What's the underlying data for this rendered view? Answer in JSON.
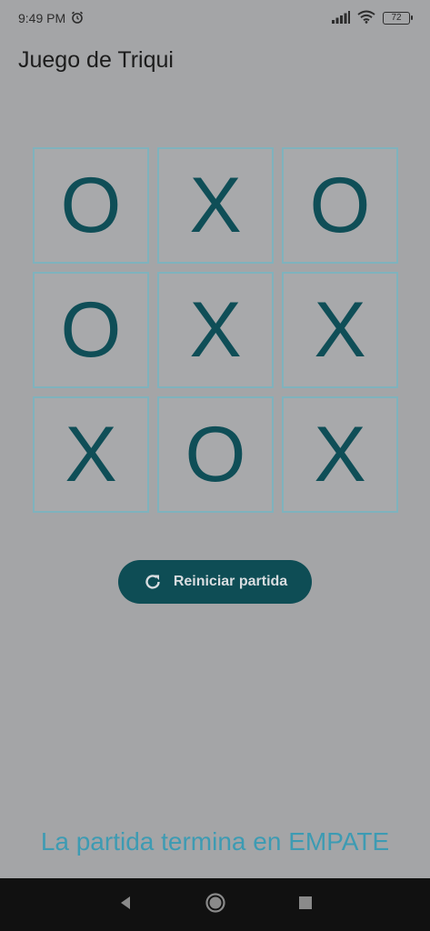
{
  "status_bar": {
    "time": "9:49 PM",
    "battery": "72",
    "icons": [
      "alarm-icon",
      "signal-icon",
      "wifi-icon",
      "battery-icon"
    ]
  },
  "app": {
    "title": "Juego de Triqui"
  },
  "board": {
    "cells": [
      "O",
      "X",
      "O",
      "O",
      "X",
      "X",
      "X",
      "O",
      "X"
    ]
  },
  "reset_button": {
    "label": "Reiniciar partida",
    "icon": "refresh-icon"
  },
  "result": {
    "message": "La partida termina en EMPATE"
  },
  "nav_bar": {
    "icons": [
      "back-icon",
      "home-icon",
      "recents-icon"
    ]
  },
  "colors": {
    "background": "#a4a5a7",
    "accent": "#0e4d55",
    "cell_border": "#7fb2bd",
    "result_text": "#3d9bb3"
  }
}
